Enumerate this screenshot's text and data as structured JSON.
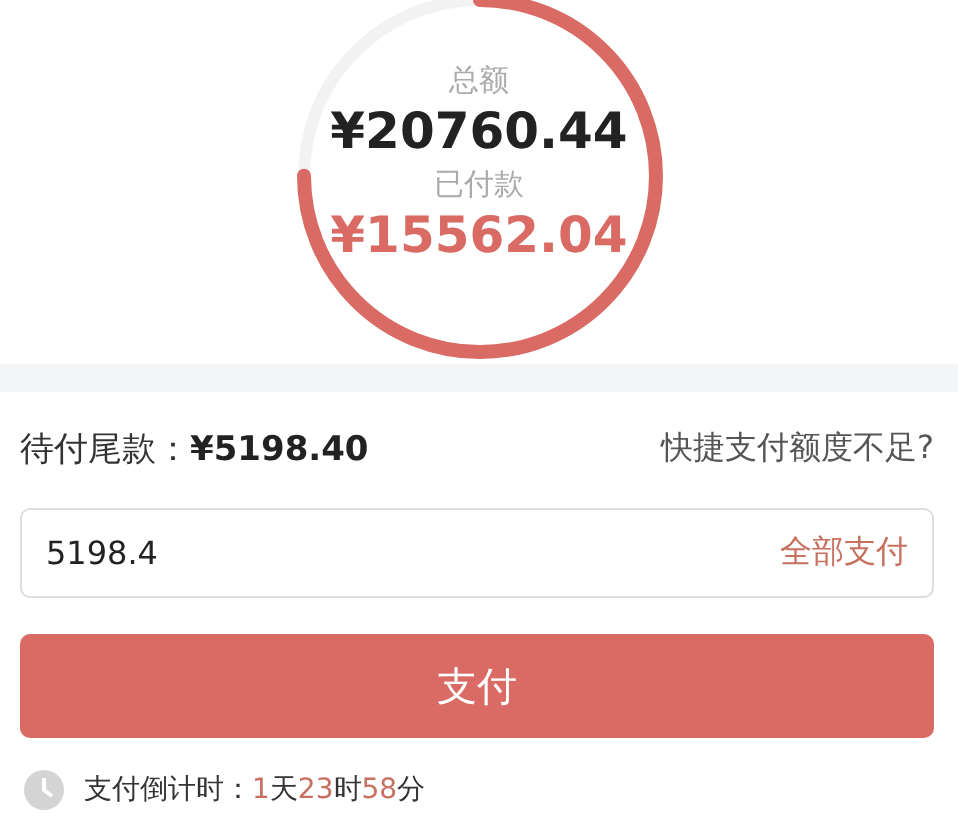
{
  "summary": {
    "total_label": "总额",
    "total": "¥20760.44",
    "paid_label": "已付款",
    "paid": "¥15562.04",
    "level": 0.75
  },
  "balance": {
    "label": "待付尾款：",
    "amount": "¥5198.40",
    "link": "快捷支付额度不足?"
  },
  "amount_field": {
    "value": "5198.4",
    "action": "全部支付"
  },
  "pay_button": "支付",
  "countdown": {
    "label": "支付倒计时：",
    "parts": [
      {
        "value": "1",
        "unit": "天"
      },
      {
        "value": "23",
        "unit": "时"
      },
      {
        "value": "58",
        "unit": "分"
      }
    ]
  }
}
